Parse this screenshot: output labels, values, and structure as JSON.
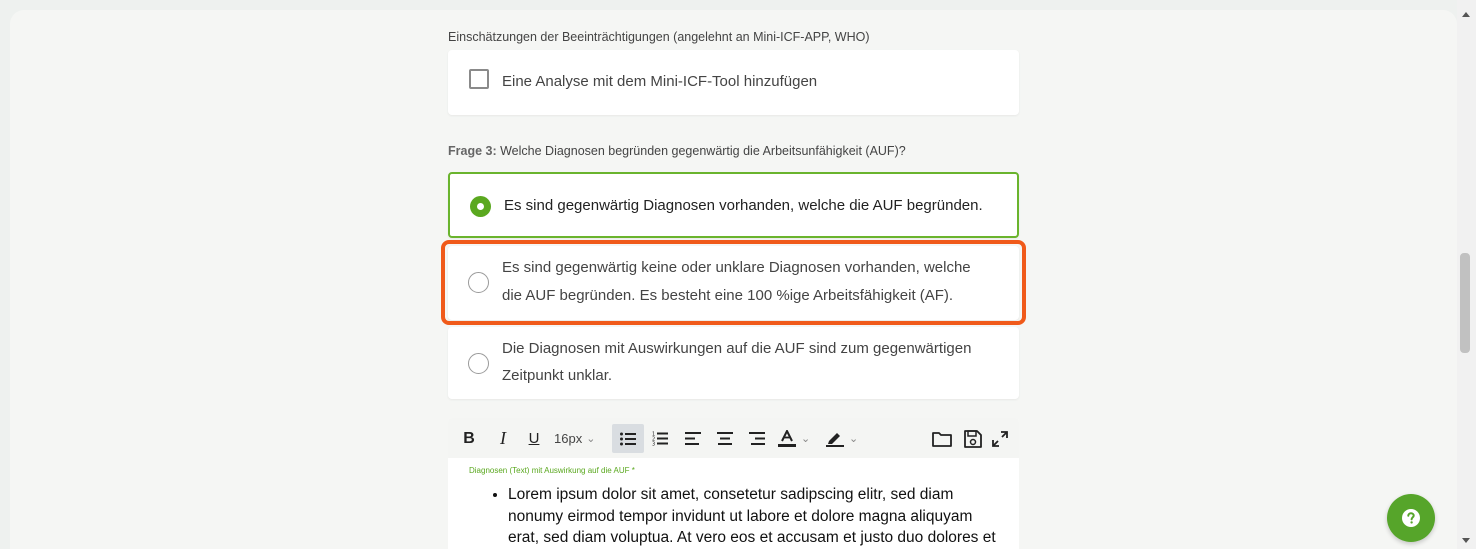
{
  "icf": {
    "section_label": "Einschätzungen der Beeinträchtigungen (angelehnt an Mini-ICF-APP, WHO)",
    "checkbox_label": "Eine Analyse mit dem Mini-ICF-Tool hinzufügen"
  },
  "question": {
    "prefix": "Frage 3:",
    "text": " Welche Diagnosen begründen gegenwärtig die Arbeitsunfähigkeit (AUF)?",
    "options": [
      {
        "line1": "Es sind gegenwärtig Diagnosen vorhanden, welche die AUF begründen.",
        "line2": "",
        "selected": true
      },
      {
        "line1": "Es sind gegenwärtig keine oder unklare Diagnosen vorhanden, welche",
        "line2": "die AUF begründen. Es besteht eine 100 %ige Arbeitsfähigkeit (AF).",
        "selected": false
      },
      {
        "line1": "Die Diagnosen mit Auswirkungen auf die AUF sind zum gegenwärtigen",
        "line2": "Zeitpunkt unklar.",
        "selected": false
      }
    ]
  },
  "editor": {
    "toolbar": {
      "bold": "B",
      "italic": "I",
      "underline": "U",
      "font_size": "16px"
    },
    "field_label": "Diagnosen (Text) mit Auswirkung auf die AUF *",
    "content_lines": [
      "Lorem ipsum dolor sit amet, consetetur sadipscing elitr, sed diam",
      "nonumy eirmod tempor invidunt ut labore et dolore magna aliquyam",
      "erat, sed diam voluptua. At vero eos et accusam et justo duo dolores et"
    ]
  },
  "colors": {
    "accent_green": "#5aa81f",
    "highlight_orange": "#f05a1a",
    "help_button": "#56a52a"
  },
  "icons": [
    "checkbox-icon",
    "radio-icon",
    "bullet-list-icon",
    "numbered-list-icon",
    "align-left-icon",
    "align-center-icon",
    "align-right-icon",
    "font-color-icon",
    "highlight-icon",
    "folder-icon",
    "save-icon",
    "expand-icon",
    "help-icon"
  ]
}
